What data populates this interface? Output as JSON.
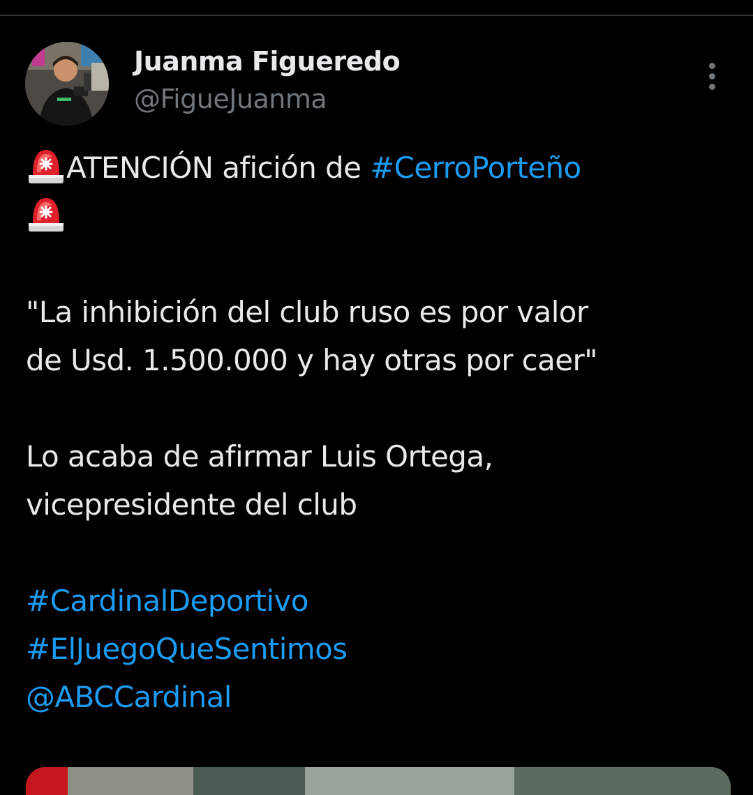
{
  "tweet": {
    "author": {
      "display_name": "Juanma Figueredo",
      "handle": "@FigueJuanma"
    },
    "more_menu_icon": "vertical-ellipsis-icon",
    "emoji_icon": "police-car-light-icon",
    "body": {
      "line1_text": "ATENCIÓN afición de ",
      "line1_hashtag": "#CerroPorteño",
      "quote_line1": "\"La inhibición del club ruso es por valor",
      "quote_line2": "de Usd. 1.500.000 y hay otras por caer\"",
      "statement_line1": "Lo acaba de afirmar Luis Ortega,",
      "statement_line2": "vicepresidente del club",
      "hashtags": [
        "#CardinalDeportivo",
        "#ElJuegoQueSentimos"
      ],
      "mention": "@ABCCardinal"
    },
    "colors": {
      "background": "#000000",
      "text": "#e7e9ea",
      "secondary_text": "#71767b",
      "link": "#1d9bf0",
      "divider": "#2f3336"
    }
  }
}
